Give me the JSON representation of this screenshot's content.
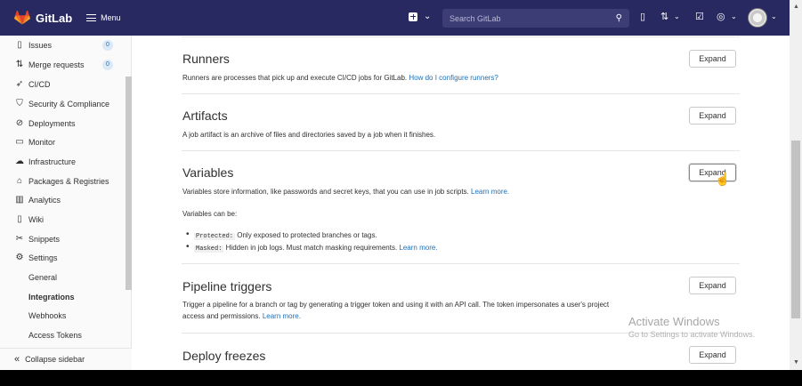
{
  "topbar": {
    "brand": "GitLab",
    "menu_label": "Menu",
    "search_placeholder": "Search GitLab",
    "icons": [
      "plus-square-icon",
      "issues-icon",
      "merge-request-icon",
      "todo-icon",
      "help-icon"
    ],
    "background": "#292961"
  },
  "sidebar": {
    "items": [
      {
        "label": "Issues",
        "icon": "issues-icon",
        "badge": "0"
      },
      {
        "label": "Merge requests",
        "icon": "merge-request-icon",
        "badge": "0"
      },
      {
        "label": "CI/CD",
        "icon": "rocket-icon"
      },
      {
        "label": "Security & Compliance",
        "icon": "shield-icon"
      },
      {
        "label": "Deployments",
        "icon": "deployments-icon"
      },
      {
        "label": "Monitor",
        "icon": "monitor-icon"
      },
      {
        "label": "Infrastructure",
        "icon": "cloud-icon"
      },
      {
        "label": "Packages & Registries",
        "icon": "package-icon"
      },
      {
        "label": "Analytics",
        "icon": "chart-icon"
      },
      {
        "label": "Wiki",
        "icon": "book-icon"
      },
      {
        "label": "Snippets",
        "icon": "scissors-icon"
      },
      {
        "label": "Settings",
        "icon": "gear-icon"
      }
    ],
    "sub_items": [
      {
        "label": "General"
      },
      {
        "label": "Integrations"
      },
      {
        "label": "Webhooks"
      },
      {
        "label": "Access Tokens"
      }
    ],
    "collapse_label": "Collapse sidebar"
  },
  "sections": {
    "runners": {
      "title": "Runners",
      "desc": "Runners are processes that pick up and execute CI/CD jobs for GitLab.",
      "link": "How do I configure runners?",
      "button": "Expand"
    },
    "artifacts": {
      "title": "Artifacts",
      "desc": "A job artifact is an archive of files and directories saved by a job when it finishes.",
      "button": "Expand"
    },
    "variables": {
      "title": "Variables",
      "desc": "Variables store information, like passwords and secret keys, that you can use in job scripts.",
      "link": "Learn more.",
      "can_be": "Variables can be:",
      "protected_code": "Protected:",
      "protected_text": "Only exposed to protected branches or tags.",
      "masked_code": "Masked:",
      "masked_text": "Hidden in job logs. Must match masking requirements.",
      "masked_link": "Learn more.",
      "button": "Expand"
    },
    "triggers": {
      "title": "Pipeline triggers",
      "desc1": "Trigger a pipeline for a branch or tag by generating a trigger token and using it with an API call. The token impersonates a user's project",
      "desc2": "access and permissions.",
      "link": "Learn more.",
      "button": "Expand"
    },
    "freezes": {
      "title": "Deploy freezes",
      "button": "Expand"
    }
  },
  "watermark": {
    "line1": "Activate Windows",
    "line2": "Go to Settings to activate Windows."
  }
}
